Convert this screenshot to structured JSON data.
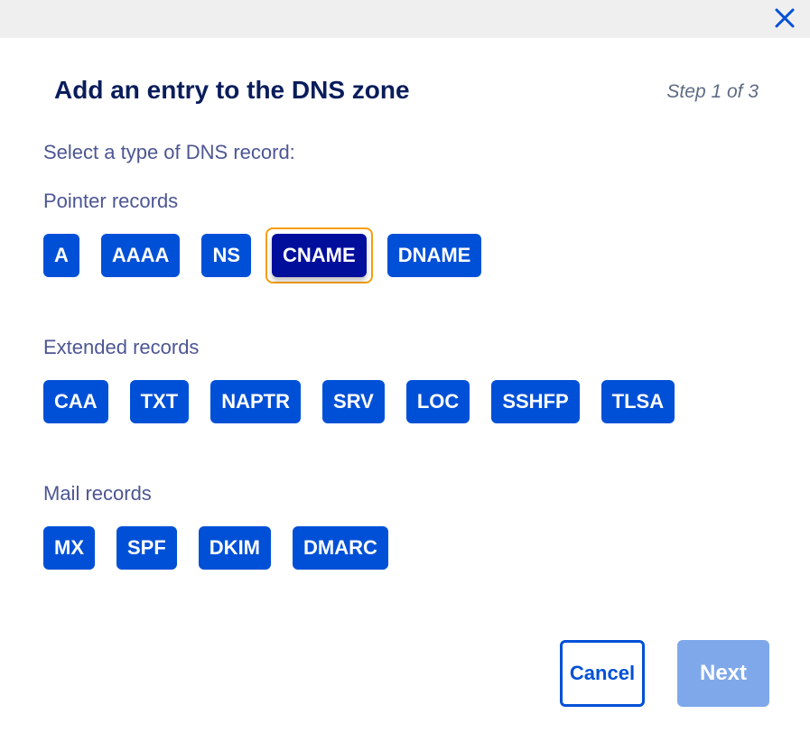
{
  "dialog": {
    "title": "Add an entry to the DNS zone",
    "step": "Step 1 of 3",
    "subtitle": "Select a type of DNS record:",
    "close_icon": "close-icon"
  },
  "groups": {
    "pointer": {
      "label": "Pointer records",
      "items": [
        "A",
        "AAAA",
        "NS",
        "CNAME",
        "DNAME"
      ],
      "selected": "CNAME"
    },
    "extended": {
      "label": "Extended records",
      "items": [
        "CAA",
        "TXT",
        "NAPTR",
        "SRV",
        "LOC",
        "SSHFP",
        "TLSA"
      ]
    },
    "mail": {
      "label": "Mail records",
      "items": [
        "MX",
        "SPF",
        "DKIM",
        "DMARC"
      ]
    }
  },
  "actions": {
    "cancel_label": "Cancel",
    "next_label": "Next",
    "next_enabled": false
  },
  "colors": {
    "primary": "#0050d7",
    "selected": "#000e9c",
    "focus_ring": "#f59e0b",
    "disabled": "#7fa8ea",
    "title": "#0a1d5b",
    "label": "#4d5693"
  }
}
